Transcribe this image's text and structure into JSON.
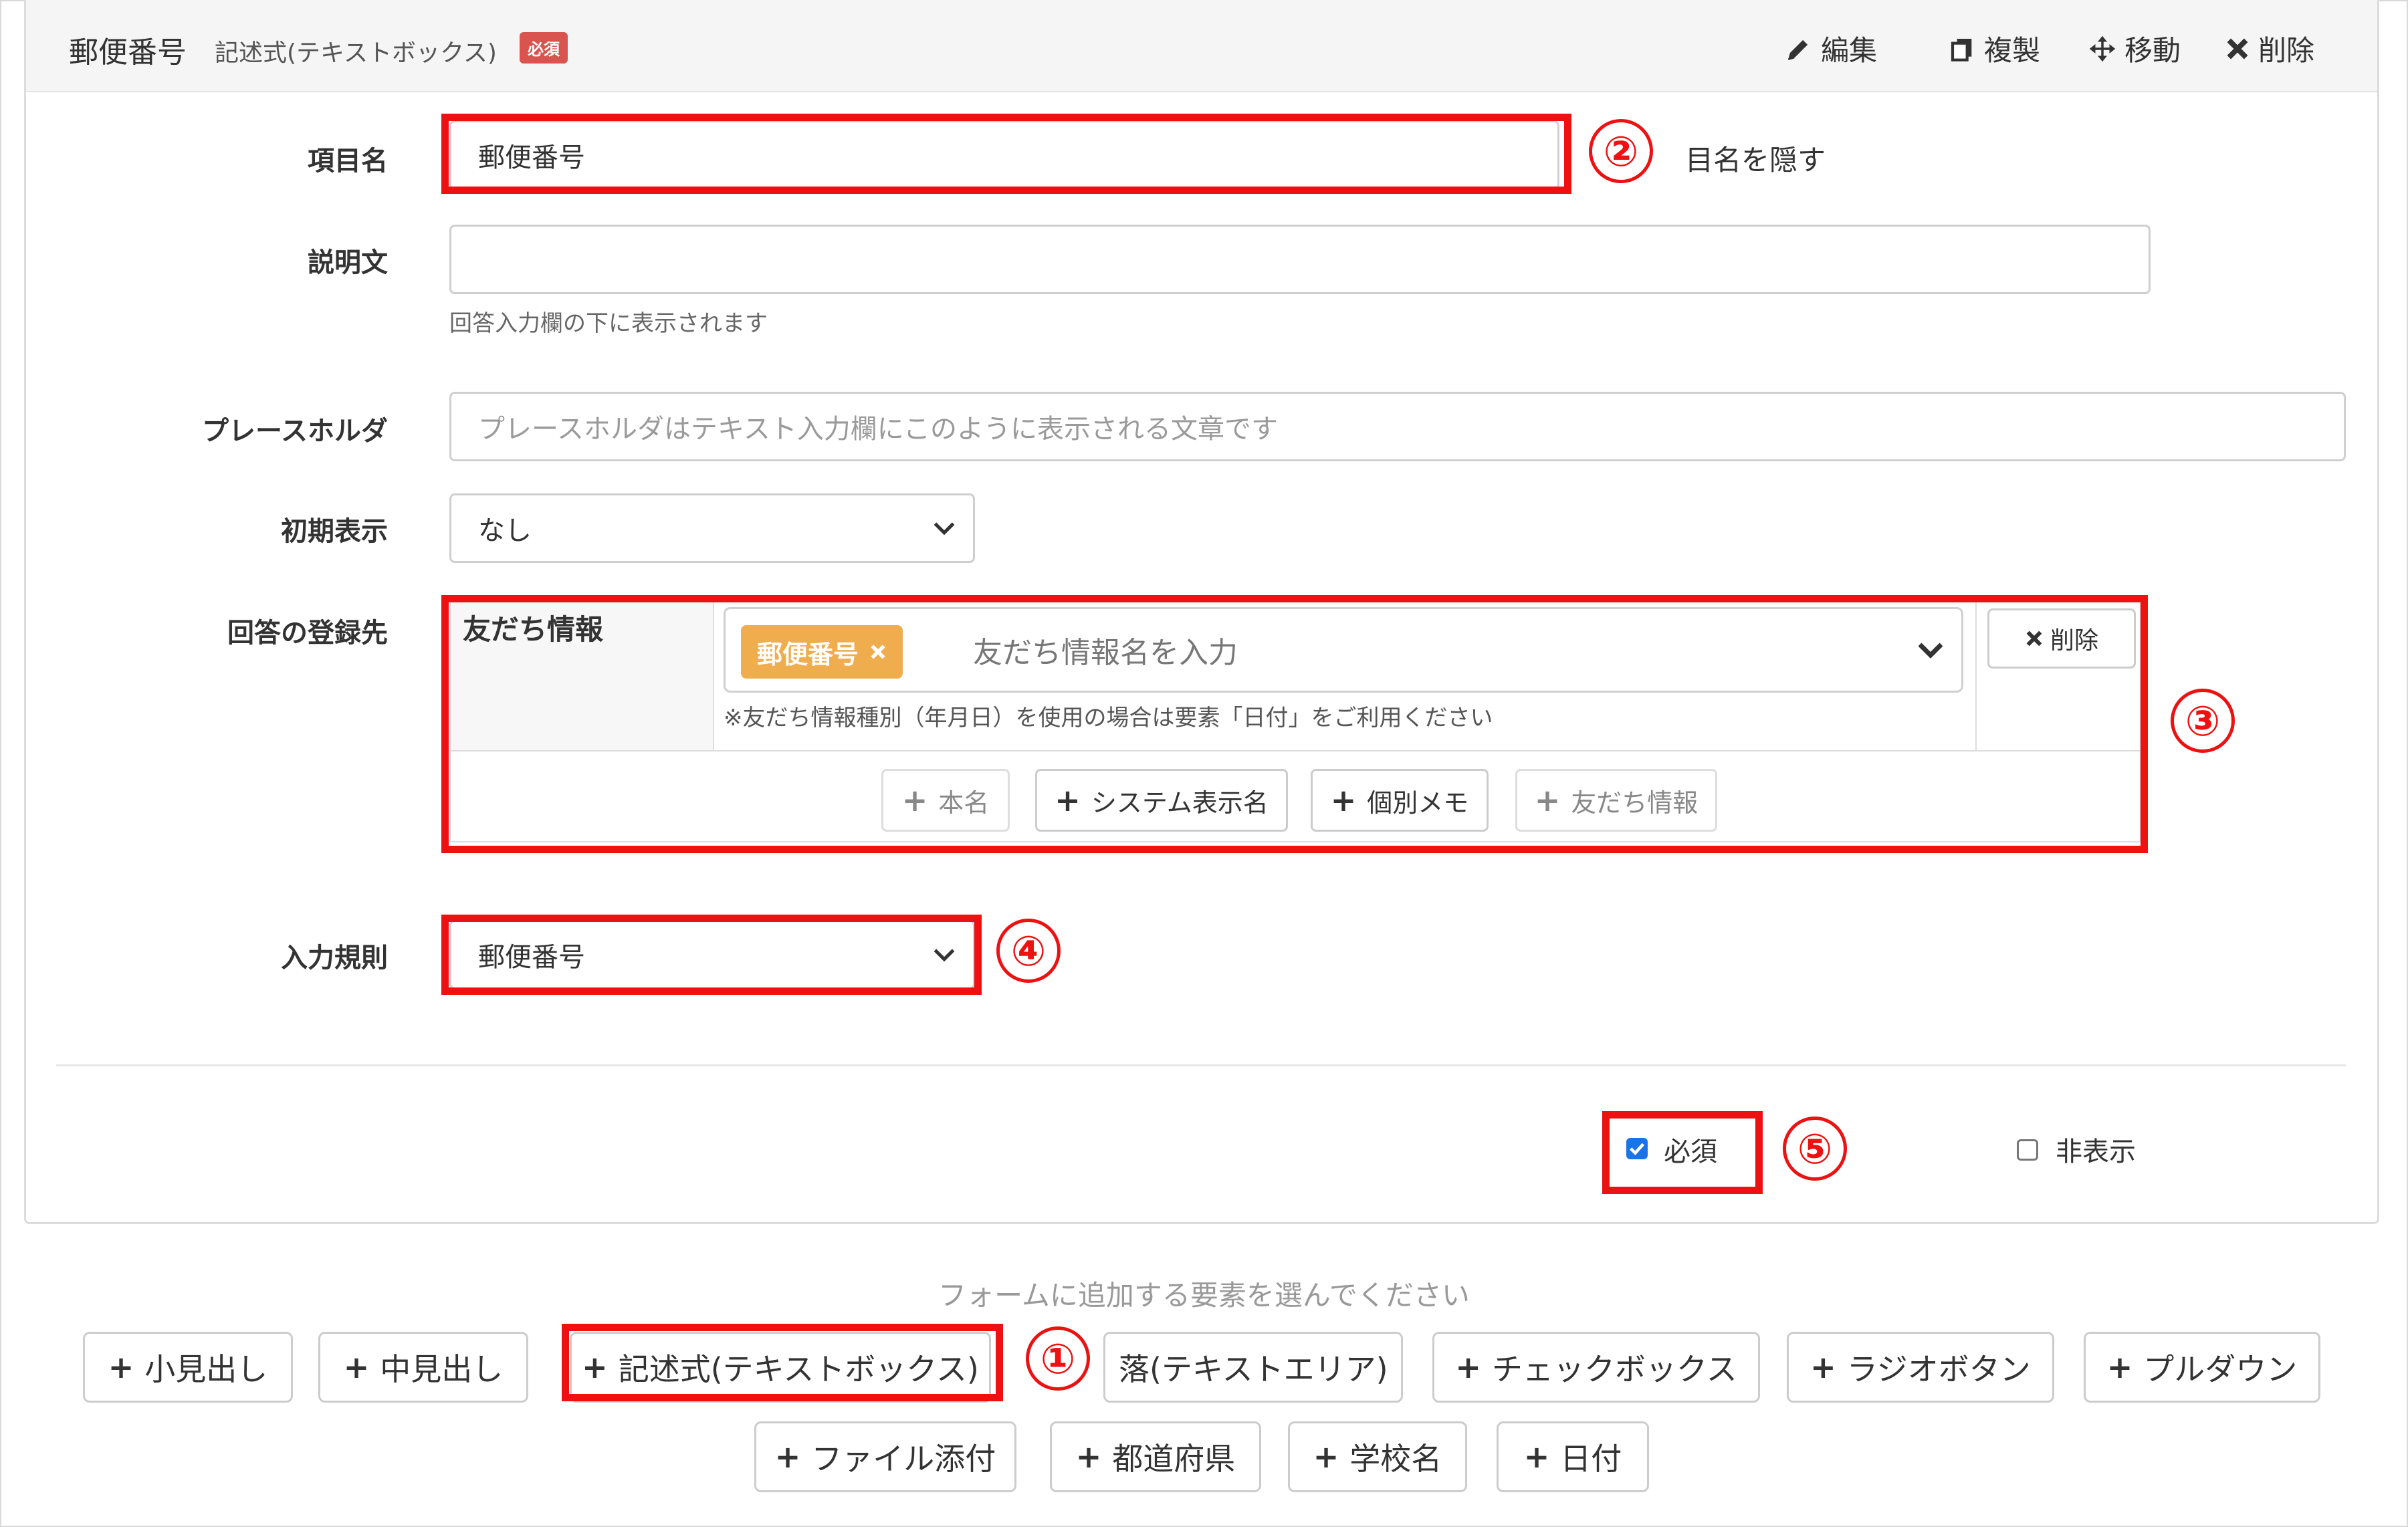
{
  "header": {
    "title": "郵便番号",
    "subtitle": "記述式(テキストボックス)",
    "required_badge": "必須",
    "actions": {
      "edit": "編集",
      "duplicate": "複製",
      "move": "移動",
      "delete": "削除"
    }
  },
  "fields": {
    "item_name": {
      "label": "項目名",
      "value": "郵便番号",
      "hide_label": "目名を隠す"
    },
    "description": {
      "label": "説明文",
      "value": "",
      "help": "回答入力欄の下に表示されます"
    },
    "placeholder": {
      "label": "プレースホルダ",
      "placeholder": "プレースホルダはテキスト入力欄にこのように表示される文章です"
    },
    "initial_display": {
      "label": "初期表示",
      "selected": "なし"
    },
    "answer_destination": {
      "label": "回答の登録先",
      "row_label": "友だち情報",
      "tag": "郵便番号",
      "input_placeholder": "友だち情報名を入力",
      "note": "※友だち情報種別（年月日）を使用の場合は要素「日付」をご利用ください",
      "delete_label": "削除",
      "add_buttons": [
        "本名",
        "システム表示名",
        "個別メモ",
        "友だち情報"
      ]
    },
    "input_rule": {
      "label": "入力規則",
      "selected": "郵便番号"
    }
  },
  "options": {
    "required": {
      "label": "必須",
      "checked": true
    },
    "hidden": {
      "label": "非表示",
      "checked": false
    }
  },
  "add_elements": {
    "prompt": "フォームに追加する要素を選んでください",
    "row1": [
      "小見出し",
      "中見出し",
      "記述式(テキストボックス)",
      "落(テキストエリア)",
      "チェックボックス",
      "ラジオボタン",
      "プルダウン"
    ],
    "row2": [
      "ファイル添付",
      "都道府県",
      "学校名",
      "日付"
    ]
  },
  "annotations": [
    "②",
    "③",
    "④",
    "⑤",
    "①"
  ],
  "colors": {
    "highlight_red": "#ee1111",
    "badge_red": "#d9534f",
    "tag_orange": "#f0ad4e",
    "checkbox_blue": "#1a73e8"
  }
}
